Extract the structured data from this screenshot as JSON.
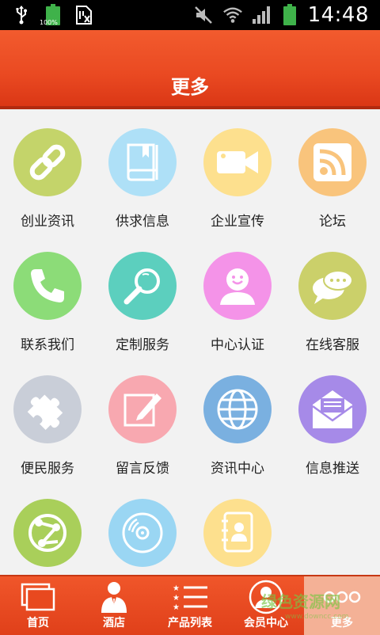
{
  "status_bar": {
    "battery_level": "100%",
    "time": "14:48",
    "icons": [
      "usb-icon",
      "battery-icon",
      "sim-icon",
      "mute-icon",
      "wifi-icon",
      "signal-icon",
      "battery-icon"
    ]
  },
  "header": {
    "title": "更多"
  },
  "grid_items": [
    {
      "label": "创业资讯",
      "icon": "link-icon",
      "color": "#c4d46a"
    },
    {
      "label": "供求信息",
      "icon": "book-icon",
      "color": "#aee0f7"
    },
    {
      "label": "企业宣传",
      "icon": "video-camera-icon",
      "color": "#fde08e"
    },
    {
      "label": "论坛",
      "icon": "rss-icon",
      "color": "#f9c47c"
    },
    {
      "label": "联系我们",
      "icon": "phone-icon",
      "color": "#8cdc78"
    },
    {
      "label": "定制服务",
      "icon": "magnifier-icon",
      "color": "#5ccfbe"
    },
    {
      "label": "中心认证",
      "icon": "user-icon",
      "color": "#f493e8"
    },
    {
      "label": "在线客服",
      "icon": "chat-icon",
      "color": "#cbd06a"
    },
    {
      "label": "便民服务",
      "icon": "puzzle-icon",
      "color": "#c9ced8"
    },
    {
      "label": "留言反馈",
      "icon": "edit-icon",
      "color": "#f8a8b0"
    },
    {
      "label": "资讯中心",
      "icon": "globe-icon",
      "color": "#7ab0e0"
    },
    {
      "label": "信息推送",
      "icon": "mail-icon",
      "color": "#a68ae8"
    },
    {
      "label": "",
      "icon": "network-icon",
      "color": "#a9cf5a"
    },
    {
      "label": "",
      "icon": "disc-icon",
      "color": "#9ad6f3"
    },
    {
      "label": "",
      "icon": "contacts-icon",
      "color": "#fde08e"
    }
  ],
  "bottom_nav": [
    {
      "label": "首页",
      "icon": "home-icon"
    },
    {
      "label": "酒店",
      "icon": "person-icon"
    },
    {
      "label": "产品列表",
      "icon": "list-icon"
    },
    {
      "label": "会员中心",
      "icon": "member-icon"
    },
    {
      "label": "更多",
      "icon": "more-icon",
      "active": true
    }
  ],
  "watermark": {
    "text": "绿色资源网",
    "sub": "www.downcc.com"
  }
}
